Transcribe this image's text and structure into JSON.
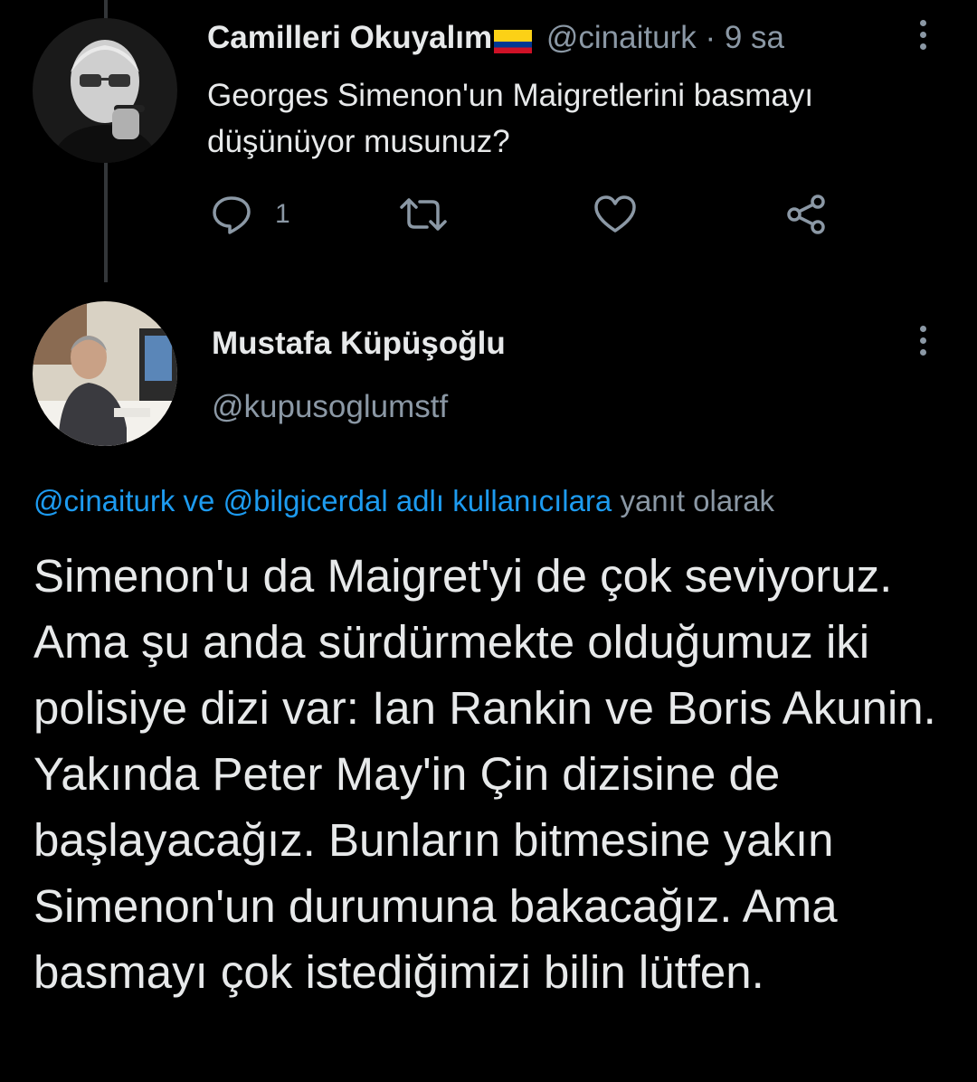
{
  "tweet_parent": {
    "display_name": "Camilleri Okuyalım",
    "flag_icon": "colombia-flag",
    "handle": "@cinaiturk",
    "separator": "·",
    "timestamp": "9 sa",
    "text": "Georges Simenon'un Maigretlerini basmayı düşünüyor musunuz?",
    "reply_count": "1"
  },
  "tweet_main": {
    "display_name": "Mustafa Küpüşoğlu",
    "handle": "@kupusoglumstf",
    "reply_to_users": "@cinaiturk ve @bilgicerdal adlı kullanıcılara",
    "reply_to_suffix": "yanıt olarak",
    "text": "Simenon'u da Maigret'yi de çok seviyoruz. Ama şu anda sürdürmekte olduğumuz iki polisiye dizi var: Ian Rankin ve Boris Akunin. Yakında Peter May'in Çin dizisine de başlayacağız. Bunların bitmesine yakın Simenon'un durumuna bakacağız. Ama basmayı çok istediğimizi bilin lütfen."
  },
  "colors": {
    "background": "#000000",
    "text_primary": "#e7e9ea",
    "text_secondary": "#8b98a5",
    "link": "#1d9bf0"
  },
  "icons": [
    "reply-icon",
    "retweet-icon",
    "like-icon",
    "share-icon",
    "more-options-icon"
  ]
}
